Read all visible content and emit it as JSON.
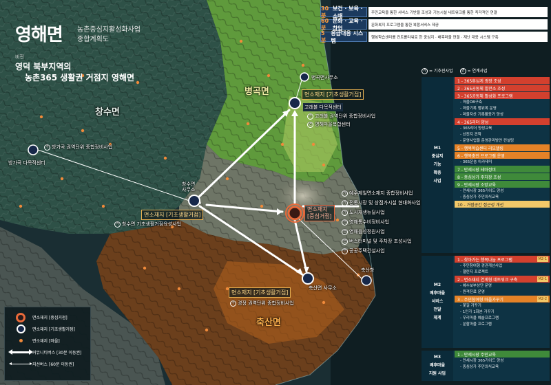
{
  "title": {
    "main": "영해면",
    "sub1": "농촌중심지활성화사업",
    "sub2": "종합계획도",
    "vision_label": "비전",
    "vision_line1": "영덕 북부지역의",
    "vision_line2": "농촌365 생활권 거점지 영해면"
  },
  "top_strip": [
    {
      "time": "30분",
      "label": "보건 · 보육 · 소매",
      "desc": "주민교육을 통한 서비스 기반을 조성과 기능시설 네트워크를 통한 즉각적인 연결"
    },
    {
      "time": "60분",
      "label": "문화 · 교육 · 창업",
      "desc": "문화복지 프로그램을 통한 복합서비스 제공"
    },
    {
      "time": "5분",
      "label": "응급대응 시스템",
      "desc": "행복학습센터를 컨트롤타워로 한 중심지 · 배후마을 연결 · 재난 대응 시스템 구축"
    }
  ],
  "legend_top": {
    "badge1": "가",
    "label1": "= 기추진사업",
    "badge2": "연",
    "label2": "= 연계사업"
  },
  "sections": [
    {
      "id": "M1",
      "head": [
        "M1",
        "중심지",
        "기능",
        "확충",
        "사업"
      ],
      "items": [
        {
          "type": "bar",
          "color": "red",
          "text": "1 - 365휴심게 광장 조성"
        },
        {
          "type": "bar",
          "color": "red",
          "text": "2 - 365공동체 발전소 조성"
        },
        {
          "type": "bar",
          "color": "red",
          "text": "3 - 365공동체 활성화 프로그램"
        },
        {
          "type": "sub",
          "text": "- 마을DB구축"
        },
        {
          "type": "sub",
          "text": "- 마을기록 행위록 운영"
        },
        {
          "type": "sub",
          "text": "- 마을자산 기록활동가 양성"
        },
        {
          "type": "bar",
          "color": "red",
          "text": "4 - 365리더 양성"
        },
        {
          "type": "sub",
          "text": "- 365리더 양성교육"
        },
        {
          "type": "sub",
          "text": "- 선진지 견학"
        },
        {
          "type": "sub",
          "text": "- 운영사업을 운영관리방안 컨설팅"
        },
        {
          "type": "bar",
          "color": "orange",
          "text": "5 - 행복학습센터 리모델링"
        },
        {
          "type": "bar",
          "color": "orange",
          "text": "6 - 행복충전 프로그램 운영"
        },
        {
          "type": "sub",
          "text": "- 365운송 아카데미"
        },
        {
          "type": "bar",
          "color": "green",
          "text": "7 - 만세시장 테마정비"
        },
        {
          "type": "bar",
          "color": "green",
          "text": "8 - 중심상가 주차장 조성"
        },
        {
          "type": "bar",
          "color": "green",
          "text": "9 - 만세시장 소망교육"
        },
        {
          "type": "sub",
          "text": "- 만세시장 365가이드 양성"
        },
        {
          "type": "sub",
          "text": "- 중심상가 주민의식교육"
        },
        {
          "type": "bar",
          "color": "yellow",
          "text": "10 - 거점공간 접근성 개선"
        }
      ]
    },
    {
      "id": "M2",
      "head": [
        "M2",
        "배후마을",
        "서비스",
        "전달",
        "체계"
      ],
      "items": [
        {
          "type": "bar",
          "color": "red",
          "text": "1 - 찾아가는 행복나눔 프로그램",
          "tag": "M2-1"
        },
        {
          "type": "sub",
          "text": "- 주민참여형 경관개선사업"
        },
        {
          "type": "sub",
          "text": "- 챌린지 프로젝트"
        },
        {
          "type": "bar",
          "color": "red",
          "text": "2 - 면소재지 연계형 네트워크 구축",
          "tag": "M2-1"
        },
        {
          "type": "sub",
          "text": "- 예수보부상단 운영"
        },
        {
          "type": "sub",
          "text": "- 원격진료 운영"
        },
        {
          "type": "bar",
          "color": "orange",
          "text": "3 - 주민참여형 마을가꾸기",
          "tag": "M2-2"
        },
        {
          "type": "sub",
          "text": "- 꽃길 가꾸기"
        },
        {
          "type": "sub",
          "text": "- 1인가 1화분 가꾸기"
        },
        {
          "type": "sub",
          "text": "- 우리마을 예술프로그램"
        },
        {
          "type": "sub",
          "text": "- 분할마을 프로그램"
        }
      ]
    },
    {
      "id": "M3",
      "head": [
        "M3",
        "배후마을",
        "지원 사업"
      ],
      "items": [
        {
          "type": "bar",
          "color": "green",
          "text": "1 - 만세시장 주민교육"
        },
        {
          "type": "sub",
          "text": "- 만세시장 365가이드 양성"
        },
        {
          "type": "sub",
          "text": "- 중심상가 주민의식교육"
        }
      ]
    }
  ],
  "map": {
    "areas": {
      "changsu": "창수면",
      "byeonggok": "병곡면",
      "chuksan": "축산면"
    },
    "nodes": {
      "center_tag": "면소재지\n[중심거점]",
      "byeonggok_office": "병곡면사무소",
      "byeonggok_tag": "면소재지 [기초생활거점]",
      "byeonggok_center": "고래불 다목적센터",
      "changsu_office": "창수면\n사무소",
      "changsu_tag": "면소재지 [기초생활거점]",
      "chuksan_office": "축산면 사무소",
      "chuksan_tag": "면소재지 [기초생활거점]",
      "chuksan_port": "축산항",
      "bangga_center": "방가곡 다목적센터"
    },
    "projects": {
      "byeonggok": [
        "고래불 권역단위 종합정비사업",
        "영해마을복합센터"
      ],
      "changsu": "창수면 기초생활거점육성사업",
      "chuksan": "경정 권역단위 종합정비사업",
      "bangga": "방가곡 권역단위 종합정비사업",
      "center": [
        "예주제일면소재지 종합정비사업",
        "전통시장 및 상점가시설 현대화사업",
        "도시재생뉴딜사업",
        "영해통수비정비사업",
        "영해읍성정원사업",
        "버스터미널 및 주차장 조성사업",
        "공공주택건설사업"
      ]
    }
  },
  "map_legend": {
    "center": "면소재지 [중심거점]",
    "basic": "면소재지 [기초생활거점]",
    "village": "면소재지 [마을]",
    "thick_arrow": "커뮤니티버스 [30분 이동권]",
    "thin_arrow": "지선버스 [60분 이동권]"
  },
  "colors": {
    "strip_head": "#1b3a5e",
    "strip_accent": "#ff9e3d",
    "center_ring": "#e86a3a",
    "red_bar": "#d3402e",
    "orange_bar": "#e48227",
    "green_bar": "#3f8a3a",
    "yellow_bar": "#f3c969"
  }
}
